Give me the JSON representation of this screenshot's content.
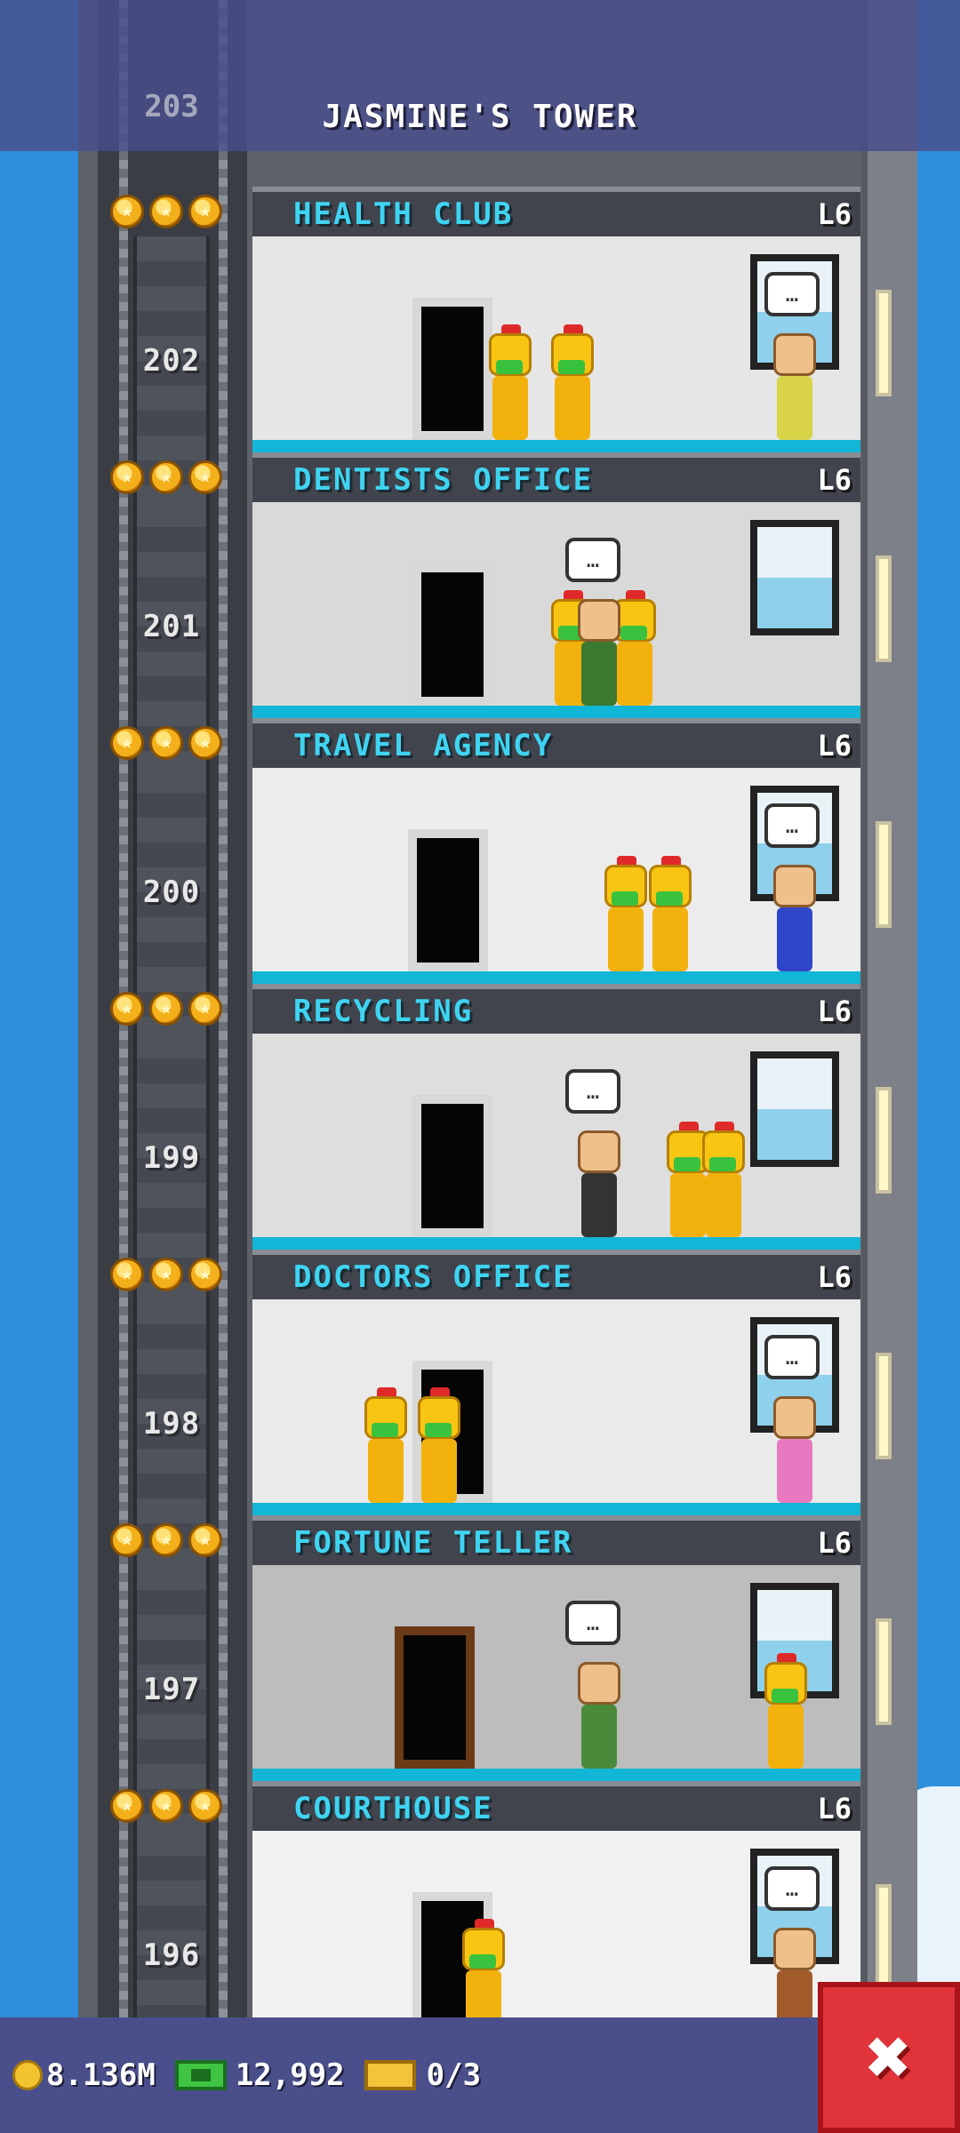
{
  "header": {
    "title": "JASMINE'S TOWER",
    "top_floor_number": "203"
  },
  "floors": [
    {
      "name": "HEALTH CLUB",
      "level": "L6",
      "number": "202",
      "stars": 3
    },
    {
      "name": "DENTISTS OFFICE",
      "level": "L6",
      "number": "201",
      "stars": 3
    },
    {
      "name": "TRAVEL AGENCY",
      "level": "L6",
      "number": "200",
      "stars": 3
    },
    {
      "name": "RECYCLING",
      "level": "L6",
      "number": "199",
      "stars": 3
    },
    {
      "name": "DOCTORS OFFICE",
      "level": "L6",
      "number": "198",
      "stars": 3
    },
    {
      "name": "FORTUNE TELLER",
      "level": "L6",
      "number": "197",
      "stars": 3
    },
    {
      "name": "COURTHOUSE",
      "level": "L6",
      "number": "196",
      "stars": 3
    }
  ],
  "bottom_bar": {
    "coins": "8.136M",
    "bux": "12,992",
    "tickets": "0/3",
    "coins_icon": "coin-icon",
    "bux_icon": "tower-bux-icon",
    "tickets_icon": "golden-ticket-icon",
    "close_icon": "close-icon",
    "close_label": "✖"
  },
  "colors": {
    "accent_label": "#3fd4f2",
    "sky": "#2f8fdc",
    "close": "#e0343a"
  }
}
